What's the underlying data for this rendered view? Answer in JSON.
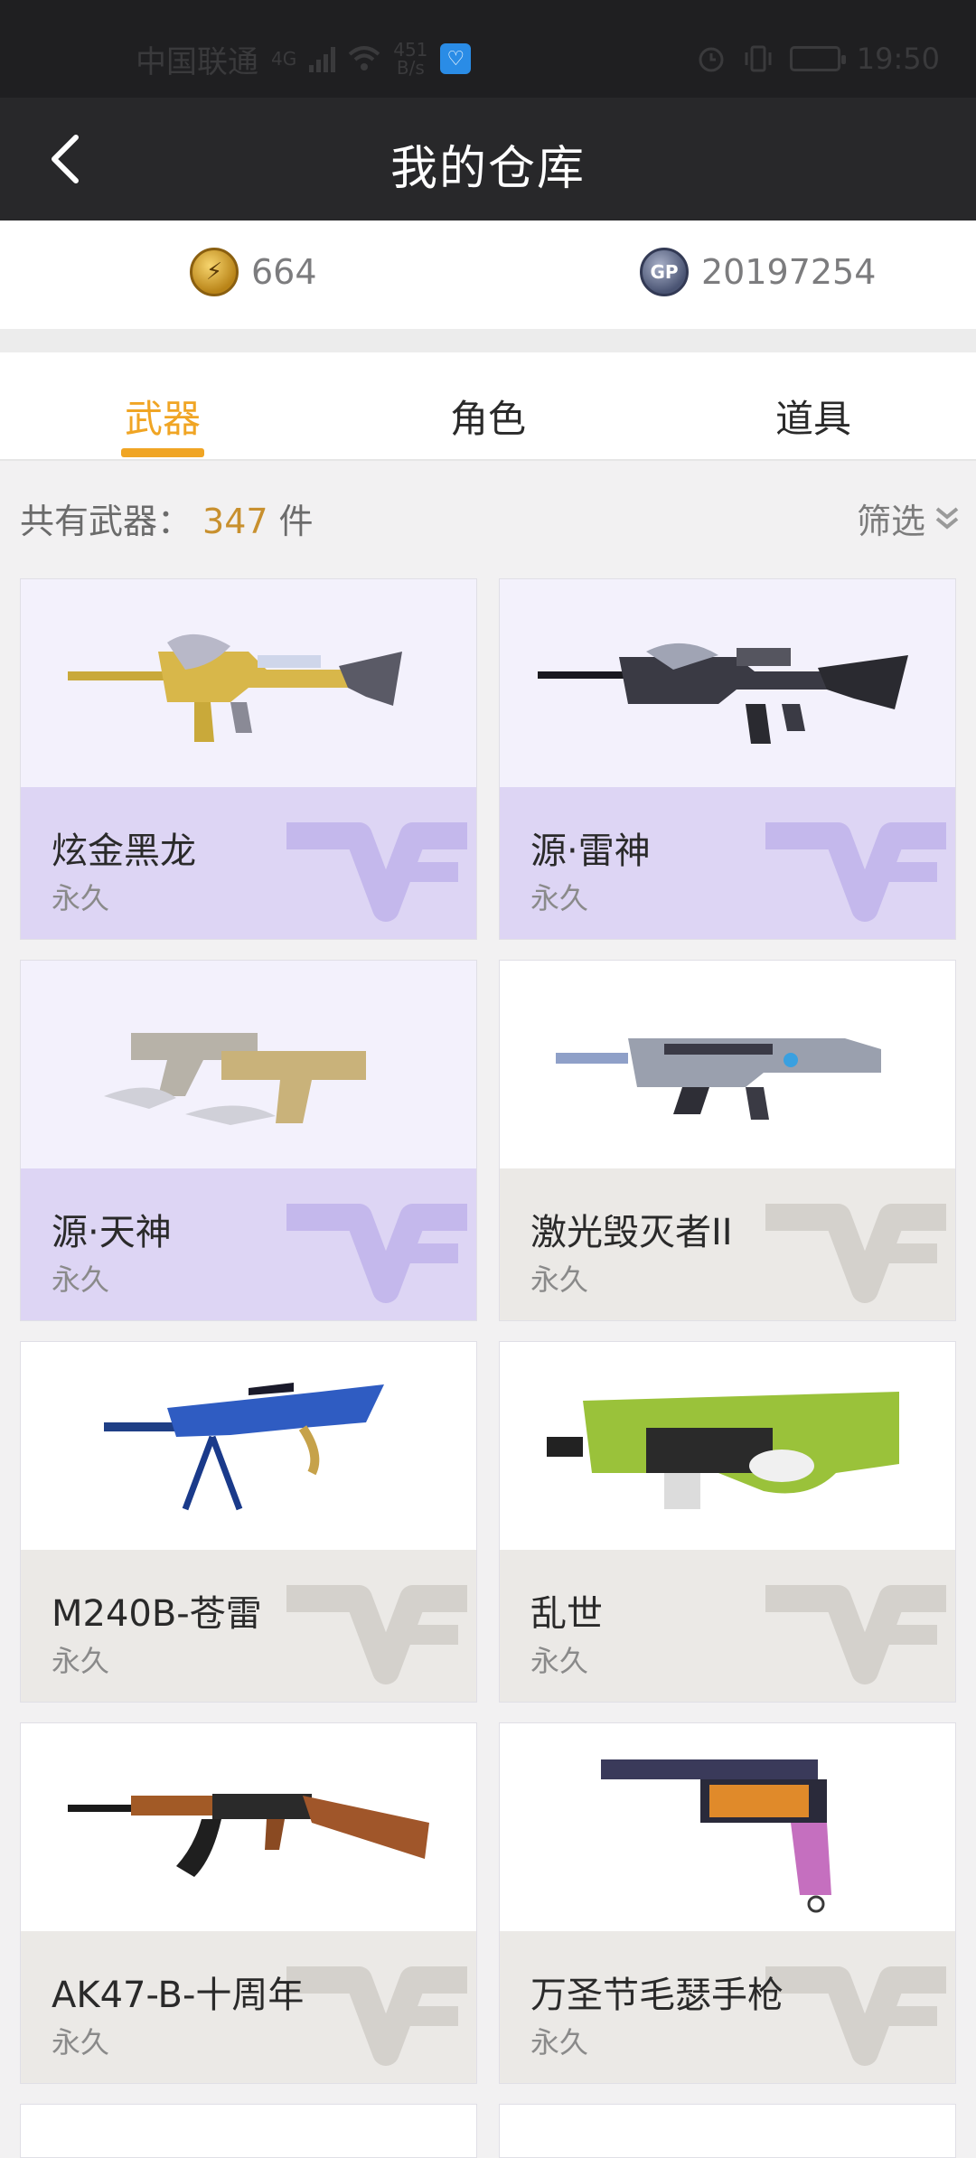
{
  "status_bar": {
    "carrier": "中国联通",
    "network": "4G",
    "speed_value": "451",
    "speed_unit": "B/s",
    "time": "19:50"
  },
  "header": {
    "title": "我的仓库"
  },
  "currency": {
    "coins": "664",
    "gp": "20197254"
  },
  "tabs": [
    {
      "label": "武器"
    },
    {
      "label": "角色"
    },
    {
      "label": "道具"
    }
  ],
  "summary": {
    "prefix": "共有武器：",
    "count": "347",
    "suffix": "件",
    "filter_label": "筛选"
  },
  "weapons": [
    {
      "name": "炫金黑龙",
      "duration": "永久",
      "theme": "purple"
    },
    {
      "name": "源·雷神",
      "duration": "永久",
      "theme": "purple"
    },
    {
      "name": "源·天神",
      "duration": "永久",
      "theme": "purple"
    },
    {
      "name": "激光毁灭者II",
      "duration": "永久",
      "theme": "grey"
    },
    {
      "name": "M240B-苍雷",
      "duration": "永久",
      "theme": "grey"
    },
    {
      "name": "乱世",
      "duration": "永久",
      "theme": "grey"
    },
    {
      "name": "AK47-B-十周年",
      "duration": "永久",
      "theme": "grey"
    },
    {
      "name": "万圣节毛瑟手枪",
      "duration": "永久",
      "theme": "grey"
    }
  ],
  "colors": {
    "accent": "#f0a524",
    "header_bg": "#28282a",
    "card_purple_bg": "#ddd5f4",
    "card_grey_bg": "#ebe9e6"
  }
}
